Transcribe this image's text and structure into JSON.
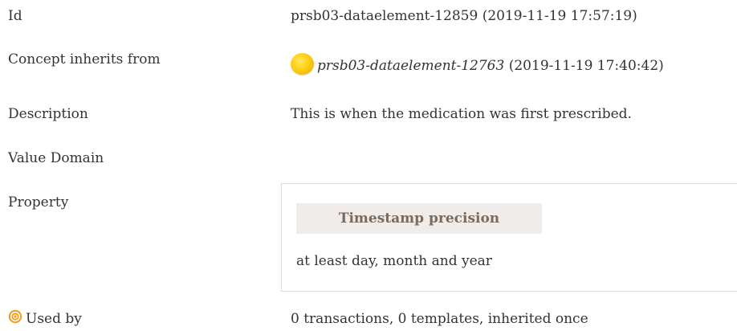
{
  "id_row": {
    "label": "Id",
    "value": "prsb03-dataelement-12859 (2019-11-19 17:57:19)"
  },
  "inherit_row": {
    "label": "Concept inherits from",
    "link": "prsb03-dataelement-12763",
    "timestamp": "(2019-11-19 17:40:42)",
    "icon": "yellow-orb-icon"
  },
  "description_row": {
    "label": "Description",
    "value": "This is when the medication was first prescribed."
  },
  "value_domain_row": {
    "label": "Value Domain"
  },
  "property_row": {
    "label": "Property",
    "header": "Timestamp precision",
    "value": "at least day, month and year"
  },
  "used_by_row": {
    "label": "Used by",
    "value": "0 transactions, 0 templates, inherited once",
    "icon": "target-icon"
  },
  "colors": {
    "text": "#333333",
    "property_header_bg": "#efecea",
    "property_header_text": "#7a6a5e",
    "box_border": "#dcdcdc",
    "orb": "#ffd21a",
    "target": "#f39a1d"
  }
}
